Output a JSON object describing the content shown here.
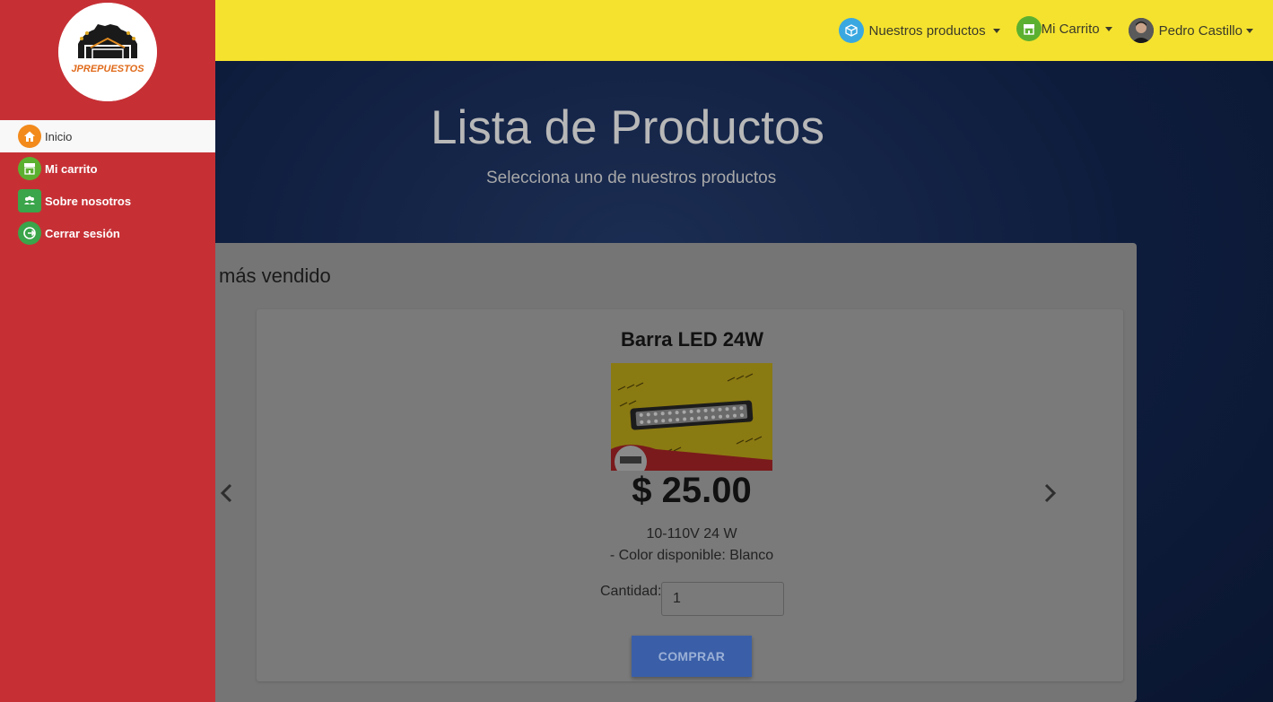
{
  "navbar": {
    "products_label": "Nuestros productos",
    "cart_label": "Mi Carrito",
    "user_name": "Pedro Castillo"
  },
  "sidebar": {
    "logo_text": "JP REPUESTOS",
    "items": [
      {
        "label": "Inicio",
        "icon": "home-icon",
        "active": true
      },
      {
        "label": "Mi carrito",
        "icon": "cart-icon",
        "active": false
      },
      {
        "label": "Sobre nosotros",
        "icon": "users-icon",
        "active": false
      },
      {
        "label": "Cerrar sesión",
        "icon": "logout-icon",
        "active": false
      }
    ]
  },
  "hero": {
    "title": "Lista de Productos",
    "subtitle": "Selecciona uno de nuestros productos"
  },
  "section": {
    "title": "más vendido"
  },
  "product": {
    "name": "Barra LED 24W",
    "price": "$ 25.00",
    "description_line1": "10-110V 24 W",
    "description_line2": "- Color disponible: Blanco",
    "quantity_label": "Cantidad:",
    "quantity_value": "1",
    "buy_label": "COMPRAR"
  },
  "colors": {
    "sidebar": "#c63035",
    "navbar": "#f5e22e",
    "button": "#3a5fa8"
  }
}
